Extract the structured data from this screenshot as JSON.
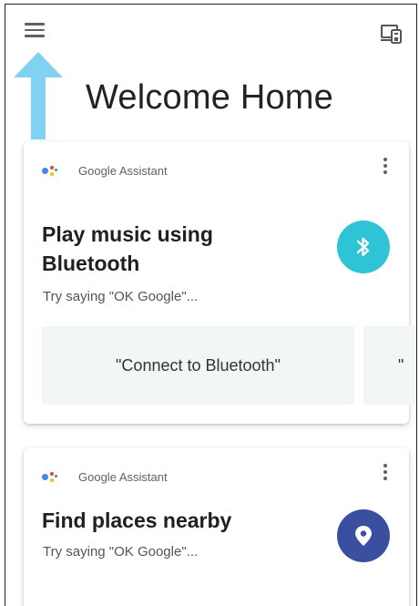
{
  "header": {
    "menu_icon": "hamburger-menu-icon",
    "cast_icon": "devices-icon",
    "title": "Welcome Home"
  },
  "annotation": {
    "arrow_color": "#7fd3f0"
  },
  "cards": [
    {
      "source": "Google Assistant",
      "title": "Play music using Bluetooth",
      "hint": "Try saying \"OK Google\"...",
      "icon": "bluetooth-icon",
      "icon_color": "#2ec4d6",
      "suggestions": [
        "\"Connect to Bluetooth\"",
        "\""
      ]
    },
    {
      "source": "Google Assistant",
      "title": "Find places nearby",
      "hint": "Try saying \"OK Google\"...",
      "icon": "location-pin-icon",
      "icon_color": "#3a4fa0"
    }
  ]
}
